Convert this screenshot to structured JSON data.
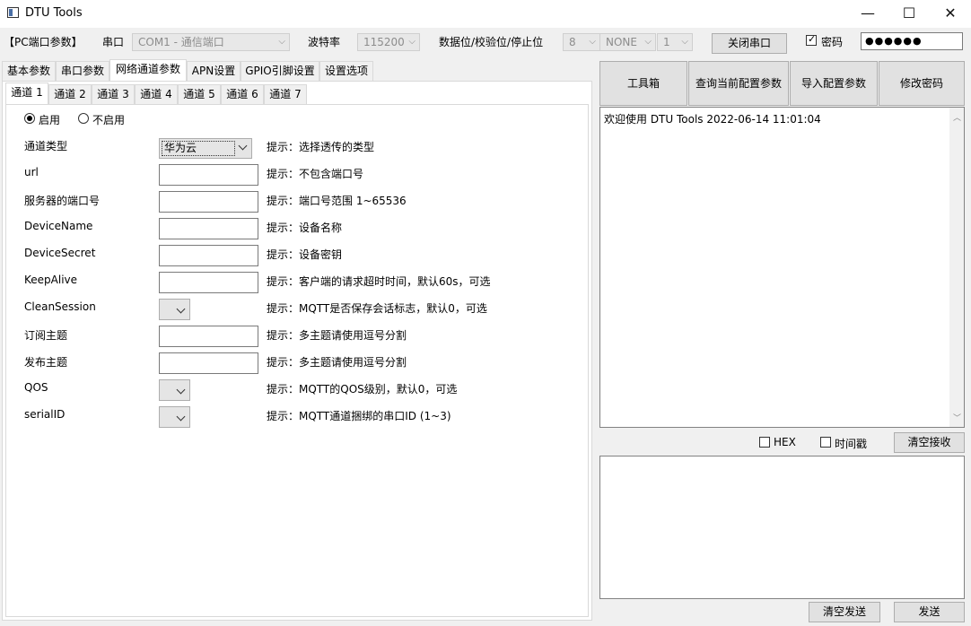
{
  "window": {
    "title": "DTU Tools",
    "minimize": "—",
    "maximize": "☐",
    "close": "✕"
  },
  "top": {
    "pc_port_params": "【PC端口参数】",
    "port_label": "串口",
    "port_value": "COM1 - 通信端口",
    "baud_label": "波特率",
    "baud_value": "115200",
    "databits_label": "数据位/校验位/停止位",
    "databits_value": "8",
    "parity_value": "NONE",
    "stopbits_value": "1",
    "close_port": "关闭串口",
    "password_label": "密码",
    "password_value": "●●●●●●"
  },
  "main_tabs": [
    "基本参数",
    "串口参数",
    "网络通道参数",
    "APN设置",
    "GPIO引脚设置",
    "设置选项"
  ],
  "channel_tabs": [
    "通道 1",
    "通道 2",
    "通道 3",
    "通道 4",
    "通道 5",
    "通道 6",
    "通道 7"
  ],
  "enable": {
    "on": "启用",
    "off": "不启用"
  },
  "form": {
    "channel_type_label": "通道类型",
    "channel_type_value": "华为云",
    "channel_type_hint": "提示：选择透传的类型",
    "url_label": "url",
    "url_hint": "提示：不包含端口号",
    "server_port_label": "服务器的端口号",
    "server_port_hint": "提示：端口号范围 1~65536",
    "device_name_label": "DeviceName",
    "device_name_hint": "提示：设备名称",
    "device_secret_label": "DeviceSecret",
    "device_secret_hint": "提示：设备密钥",
    "keepalive_label": "KeepAlive",
    "keepalive_hint": "提示：客户端的请求超时时间，默认60s，可选",
    "clean_session_label": "CleanSession",
    "clean_session_hint": "提示：MQTT是否保存会话标志，默认0，可选",
    "subscribe_label": "订阅主题",
    "subscribe_hint": "提示：多主题请使用逗号分割",
    "publish_label": "发布主题",
    "publish_hint": "提示：多主题请使用逗号分割",
    "qos_label": "QOS",
    "qos_hint": "提示：MQTT的QOS级别，默认0，可选",
    "serialid_label": "serialID",
    "serialid_hint": "提示：MQTT通道捆绑的串口ID (1~3)"
  },
  "right": {
    "toolbox": "工具箱",
    "query_config": "查询当前配置参数",
    "import_config": "导入配置参数",
    "change_password": "修改密码",
    "log_text": "欢迎使用 DTU Tools 2022-06-14 11:01:04",
    "hex_label": "HEX",
    "timestamp_label": "时间戳",
    "clear_receive": "清空接收",
    "clear_send": "清空发送",
    "send": "发送"
  }
}
